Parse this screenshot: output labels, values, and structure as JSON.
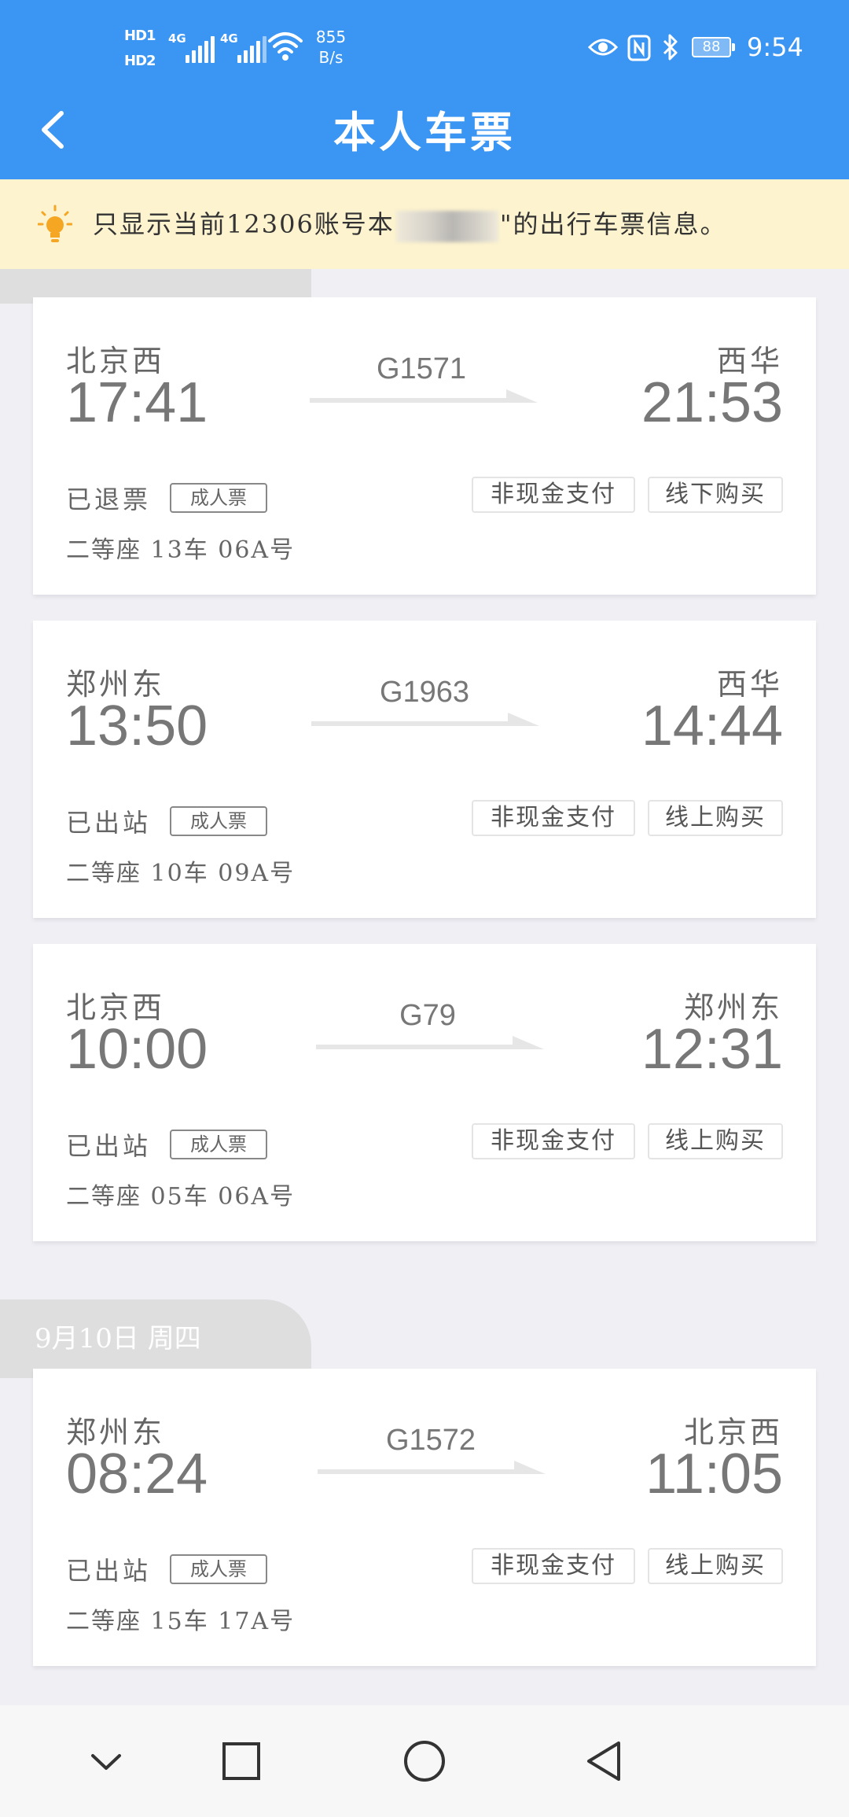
{
  "status_bar": {
    "hd1": "HD1",
    "hd2": "HD2",
    "sig1": "4G",
    "sig2": "4G",
    "net_speed": "855",
    "net_unit": "B/s",
    "battery": "88",
    "time": "9:54"
  },
  "header": {
    "title": "本人车票",
    "back_icon": "chevron-left-icon"
  },
  "notice": {
    "icon": "lightbulb-icon",
    "text_before": "只显示当前12306账号本",
    "text_after": "\"的出行车票信息。"
  },
  "date_groups": [
    {
      "label": "9月10日 周四"
    }
  ],
  "tickets": [
    {
      "from": "北京西",
      "dep": "17:41",
      "train": "G1571",
      "to": "西华",
      "arr": "21:53",
      "status": "已退票",
      "type": "成人票",
      "pay": "非现金支付",
      "buy": "线下购买",
      "seat": "二等座 13车 06A号"
    },
    {
      "from": "郑州东",
      "dep": "13:50",
      "train": "G1963",
      "to": "西华",
      "arr": "14:44",
      "status": "已出站",
      "type": "成人票",
      "pay": "非现金支付",
      "buy": "线上购买",
      "seat": "二等座 10车 09A号"
    },
    {
      "from": "北京西",
      "dep": "10:00",
      "train": "G79",
      "to": "郑州东",
      "arr": "12:31",
      "status": "已出站",
      "type": "成人票",
      "pay": "非现金支付",
      "buy": "线上购买",
      "seat": "二等座 05车 06A号"
    },
    {
      "from": "郑州东",
      "dep": "08:24",
      "train": "G1572",
      "to": "北京西",
      "arr": "11:05",
      "status": "已出站",
      "type": "成人票",
      "pay": "非现金支付",
      "buy": "线上购买",
      "seat": "二等座 15车 17A号"
    }
  ],
  "nav_bar": {
    "icons": [
      "chevron-down-icon",
      "square-recent-icon",
      "circle-home-icon",
      "triangle-back-icon"
    ]
  },
  "colors": {
    "header_blue": "#3b95f2",
    "notice_bg": "#fdf3cf",
    "page_bg": "#efeff4"
  }
}
